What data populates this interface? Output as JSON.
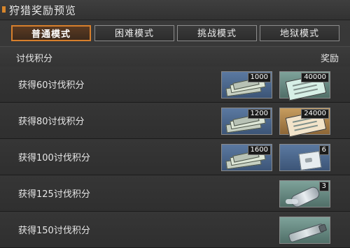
{
  "title": "狩猎奖励预览",
  "tabs": [
    {
      "label": "普通模式",
      "active": true
    },
    {
      "label": "困难模式",
      "active": false
    },
    {
      "label": "挑战模式",
      "active": false
    },
    {
      "label": "地狱模式",
      "active": false
    }
  ],
  "headers": {
    "left": "讨伐积分",
    "right": "奖励"
  },
  "rows": [
    {
      "label": "获得60讨伐积分",
      "rewards": [
        {
          "count": "1000",
          "icon": "cash-stack-icon"
        },
        {
          "count": "40000",
          "icon": "green-document-icon"
        }
      ]
    },
    {
      "label": "获得80讨伐积分",
      "rewards": [
        {
          "count": "1200",
          "icon": "cash-stack-icon"
        },
        {
          "count": "24000",
          "icon": "tan-document-icon"
        }
      ]
    },
    {
      "label": "获得100讨伐积分",
      "rewards": [
        {
          "count": "1600",
          "icon": "cash-stack-icon"
        },
        {
          "count": "6",
          "icon": "bag-icon"
        }
      ]
    },
    {
      "label": "获得125讨伐积分",
      "rewards": [
        {
          "count": "3",
          "icon": "spilled-can-icon"
        }
      ]
    },
    {
      "label": "获得150讨伐积分",
      "rewards": [
        {
          "count": "",
          "icon": "metal-tube-icon"
        }
      ]
    }
  ]
}
